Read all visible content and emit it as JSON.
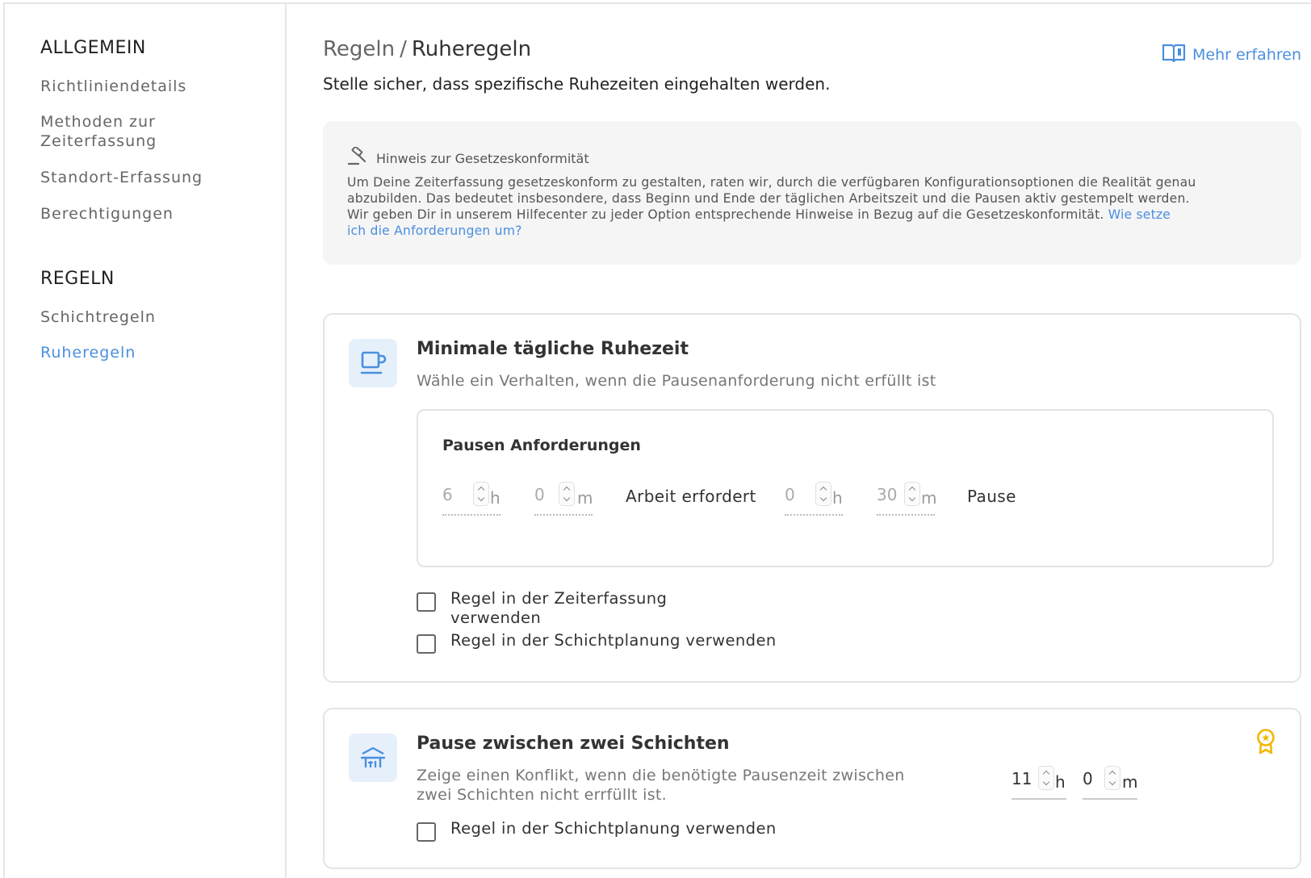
{
  "sidebar": {
    "section_general": "ALLGEMEIN",
    "general_items": [
      "Richtliniendetails",
      "Methoden zur",
      "Zeiterfassung",
      "Standort-Erfassung",
      "Berechtigungen"
    ],
    "section_rules": "REGELN",
    "rule_items": [
      "Schichtregeln",
      "Ruheregeln"
    ]
  },
  "header": {
    "crumb_parent": "Regeln",
    "crumb_sep": "/",
    "crumb_current": "Ruheregeln",
    "subtitle": "Stelle sicher, dass spezifische Ruhezeiten eingehalten werden.",
    "learn_more": "Mehr erfahren"
  },
  "notice": {
    "title": "Hinweis zur Gesetzeskonformität",
    "line1": "Um Deine Zeiterfassung gesetzeskonform zu gestalten, raten wir, durch die verfügbaren Konfigurationsoptionen die Realität genau",
    "line2": "abzubilden. Das bedeutet insbesondere, dass Beginn und Ende der täglichen Arbeitszeit und die Pausen aktiv gestempelt werden.",
    "line3": "Wir geben Dir in unserem Hilfecenter zu jeder Option entsprechende Hinweise in Bezug auf die Gesetzeskonformität.",
    "link_a": "Wie setze",
    "link_b": "ich die Anforderungen um?"
  },
  "card1": {
    "title": "Minimale tägliche Ruhezeit",
    "desc": "Wähle ein Verhalten, wenn die Pausenanforderung nicht erfüllt ist",
    "inner_title": "Pausen Anforderungen",
    "work_hours": "6",
    "work_minutes": "0",
    "unit_h": "h",
    "unit_m": "m",
    "work_label": "Arbeit erfordert",
    "break_hours": "0",
    "break_minutes": "30",
    "break_label": "Pause",
    "check1_a": "Regel in der Zeiterfassung",
    "check1_b": "verwenden",
    "check2": "Regel in der Schichtplanung verwenden"
  },
  "card2": {
    "title": "Pause zwischen zwei Schichten",
    "desc_a": "Zeige einen Konflikt, wenn die benötigte Pausenzeit zwischen",
    "desc_b": "zwei Schichten nicht errfüllt ist.",
    "hours": "11",
    "minutes": "0",
    "unit_h": "h",
    "unit_m": "m",
    "check": "Regel in der Schichtplanung verwenden"
  },
  "colors": {
    "accent": "#4a8fde",
    "award": "#f2b705",
    "notice_bg": "#f5f5f5"
  }
}
